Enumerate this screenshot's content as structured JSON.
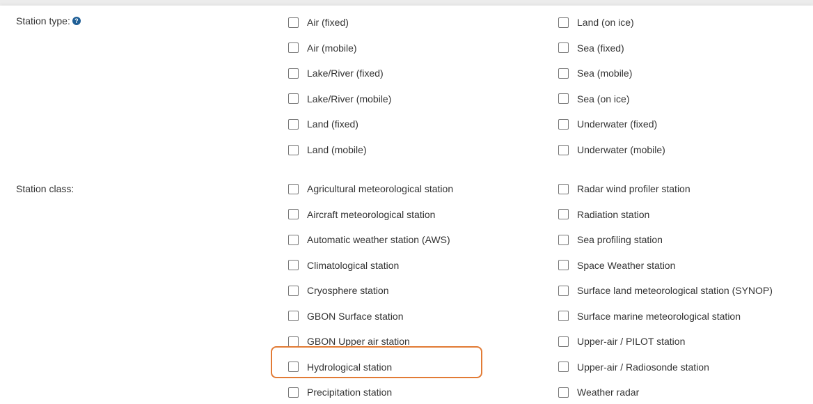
{
  "station_type": {
    "label": "Station type:",
    "help_icon": "question-circle-icon",
    "col1": [
      "Air (fixed)",
      "Air (mobile)",
      "Lake/River (fixed)",
      "Lake/River (mobile)",
      "Land (fixed)",
      "Land (mobile)"
    ],
    "col2": [
      "Land (on ice)",
      "Sea (fixed)",
      "Sea (mobile)",
      "Sea (on ice)",
      "Underwater (fixed)",
      "Underwater (mobile)"
    ]
  },
  "station_class": {
    "label": "Station class:",
    "col1": [
      "Agricultural meteorological station",
      "Aircraft meteorological station",
      "Automatic weather station (AWS)",
      "Climatological station",
      "Cryosphere station",
      "GBON Surface station",
      "GBON Upper air station",
      "Hydrological station",
      "Precipitation station"
    ],
    "col2": [
      "Radar wind profiler station",
      "Radiation station",
      "Sea profiling station",
      "Space Weather station",
      "Surface land meteorological station (SYNOP)",
      "Surface marine meteorological station",
      "Upper-air / PILOT station",
      "Upper-air / Radiosonde station",
      "Weather radar"
    ]
  },
  "colors": {
    "highlight": "#e27b35",
    "help_icon": "#1f5f96"
  }
}
